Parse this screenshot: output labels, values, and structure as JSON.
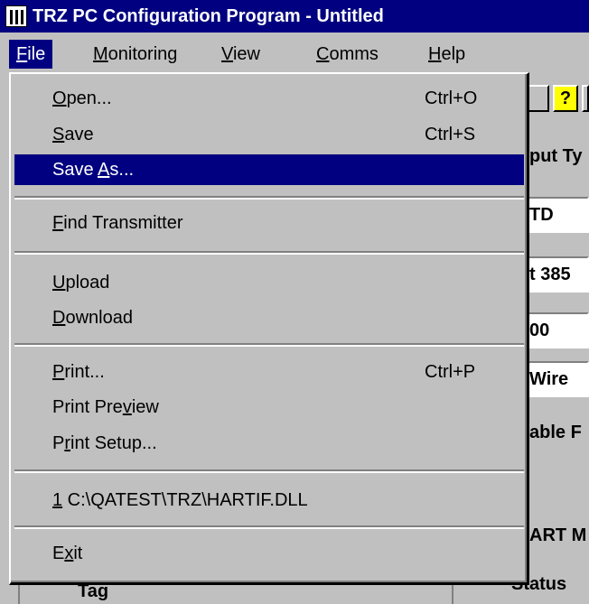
{
  "window": {
    "title": "TRZ PC Configuration Program - Untitled"
  },
  "menubar": [
    {
      "pre": "",
      "mn": "F",
      "post": "ile",
      "active": true
    },
    {
      "pre": "",
      "mn": "M",
      "post": "onitoring"
    },
    {
      "pre": "",
      "mn": "V",
      "post": "iew"
    },
    {
      "pre": "",
      "mn": "C",
      "post": "omms"
    },
    {
      "pre": "",
      "mn": "H",
      "post": "elp"
    }
  ],
  "file_menu": {
    "items": [
      {
        "pre": "",
        "mn": "O",
        "post": "pen...",
        "shortcut": "Ctrl+O"
      },
      {
        "pre": "",
        "mn": "S",
        "post": "ave",
        "shortcut": "Ctrl+S"
      },
      {
        "pre": "Save ",
        "mn": "A",
        "post": "s...",
        "shortcut": "",
        "highlighted": true
      },
      {
        "pre": "",
        "mn": "F",
        "post": "ind Transmitter",
        "shortcut": ""
      },
      {
        "pre": "",
        "mn": "U",
        "post": "pload",
        "shortcut": ""
      },
      {
        "pre": "",
        "mn": "D",
        "post": "ownload",
        "shortcut": ""
      },
      {
        "pre": "",
        "mn": "P",
        "post": "rint...",
        "shortcut": "Ctrl+P"
      },
      {
        "pre": "Print Pre",
        "mn": "v",
        "post": "iew",
        "shortcut": ""
      },
      {
        "pre": "P",
        "mn": "r",
        "post": "int Setup...",
        "shortcut": ""
      },
      {
        "pre": "",
        "mn": "1",
        "post": " C:\\QATEST\\TRZ\\HARTIF.DLL",
        "shortcut": ""
      },
      {
        "pre": "E",
        "mn": "x",
        "post": "it",
        "shortcut": ""
      }
    ]
  },
  "background": {
    "input_type_label": "put Ty",
    "sensor_value": "TD",
    "model_value": "t 385",
    "range_value": "00",
    "wires_value": " Wire",
    "enable_label": "able F",
    "hart_label": "ART M",
    "status_label": "Status",
    "tag_label": "Tag",
    "help_button": "?"
  },
  "colors": {
    "highlight": "#000080",
    "face": "#c0c0c0"
  }
}
